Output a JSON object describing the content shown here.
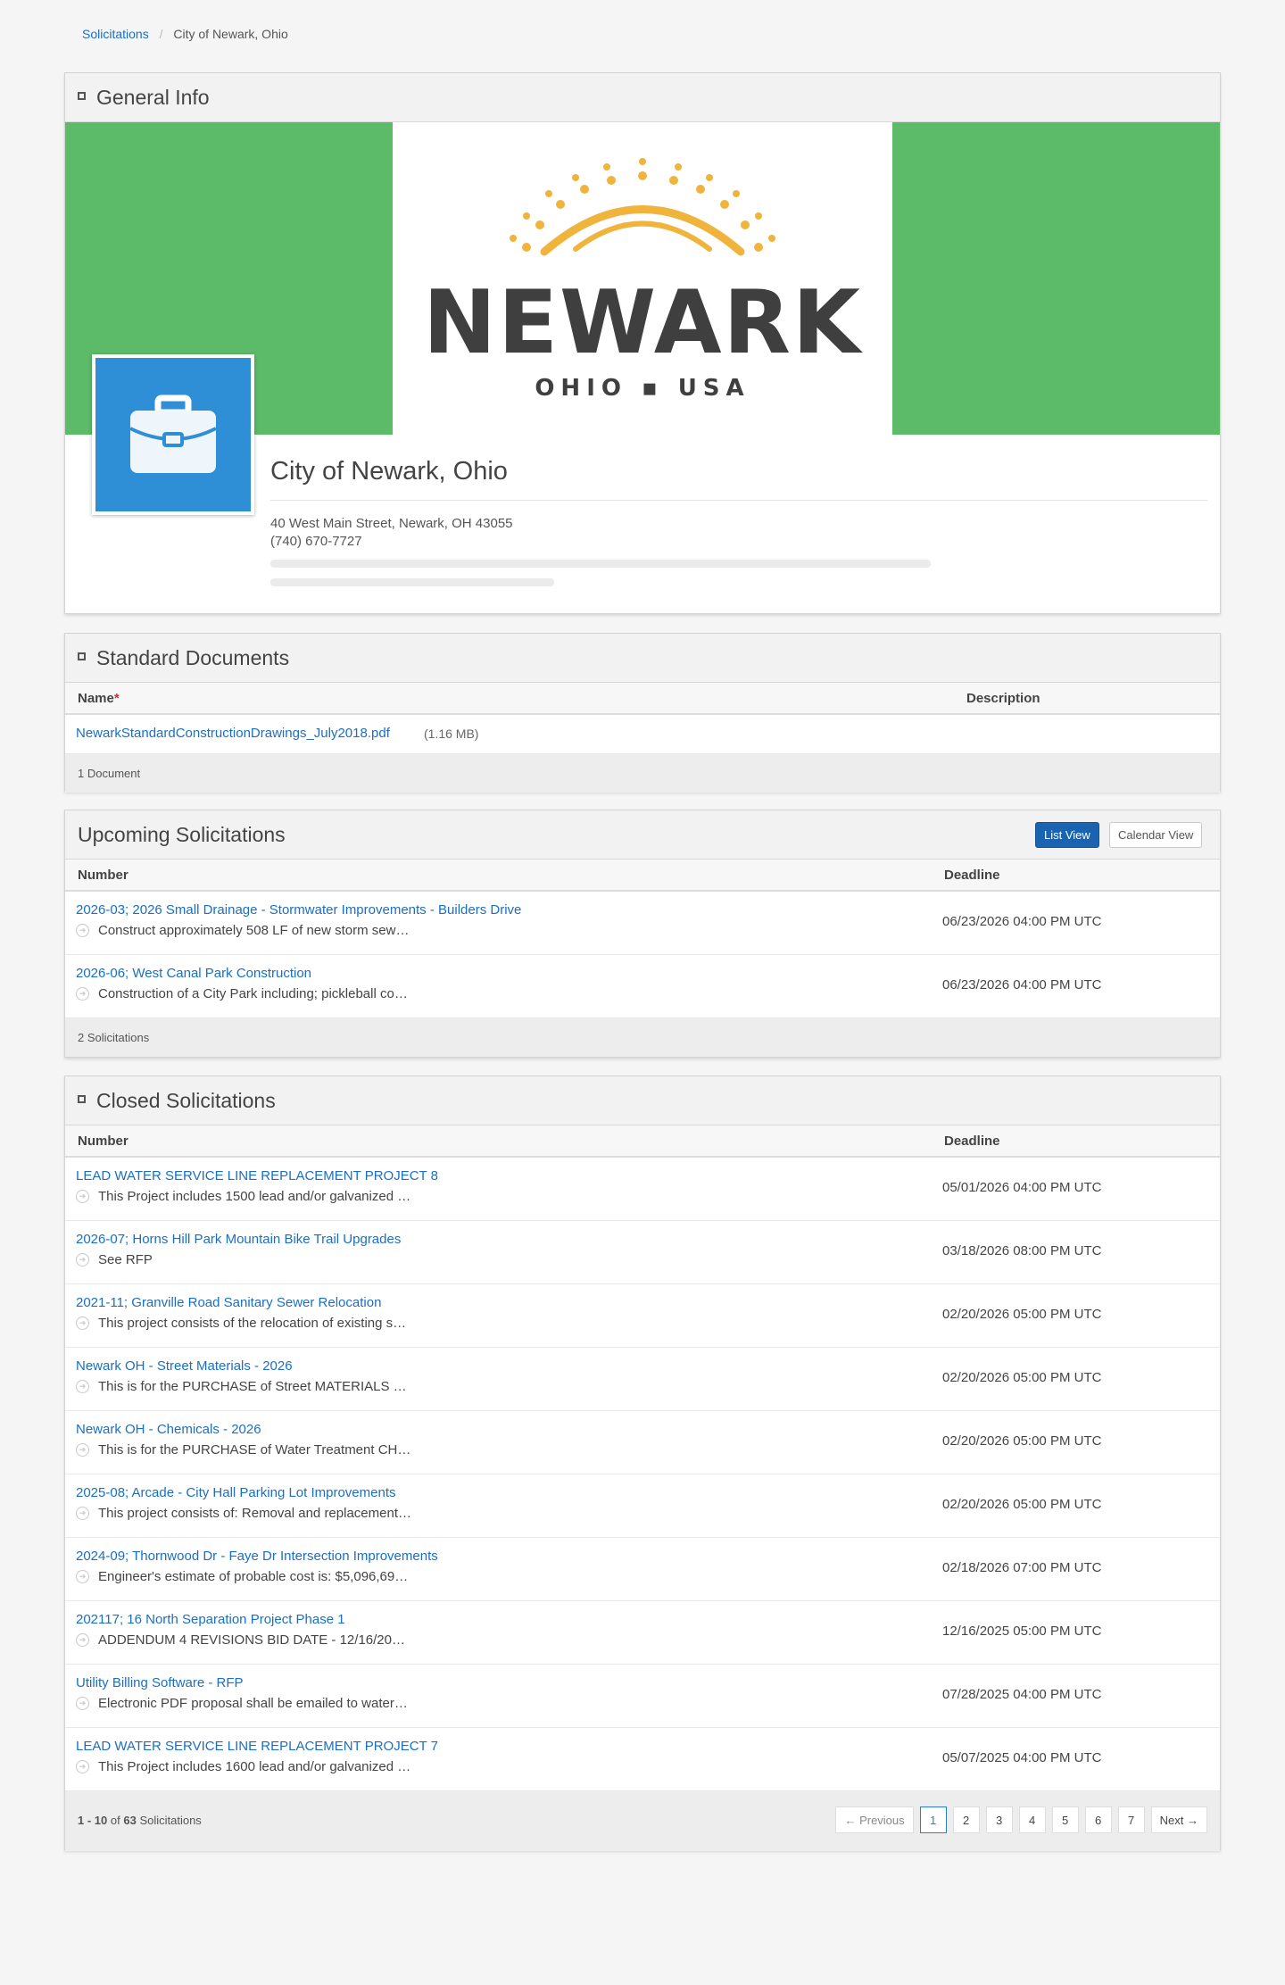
{
  "breadcrumb": {
    "parent": "Solicitations",
    "current": "City of Newark, Ohio"
  },
  "general": {
    "title": "General Info",
    "logo_word": "NEWARK",
    "logo_sub": "OHIO ▪ USA",
    "org_name": "City of Newark, Ohio",
    "address": "40 West Main Street, Newark, OH 43055",
    "phone": "(740) 670-7727"
  },
  "documents": {
    "title": "Standard Documents",
    "col_name": "Name",
    "col_desc": "Description",
    "rows": [
      {
        "name": "NewarkStandardConstructionDrawings_July2018.pdf",
        "size": "(1.16 MB)"
      }
    ],
    "count": "1 Document"
  },
  "upcoming": {
    "title": "Upcoming Solicitations",
    "list_view": "List View",
    "calendar_view": "Calendar View",
    "col_number": "Number",
    "col_deadline": "Deadline",
    "rows": [
      {
        "title": "2026-03; 2026 Small Drainage - Stormwater Improvements - Builders Drive",
        "desc": "Construct approximately 508 LF of new storm sew…",
        "deadline": "06/23/2026 04:00 PM UTC"
      },
      {
        "title": "2026-06; West Canal Park Construction",
        "desc": "Construction of a City Park including; pickleball co…",
        "deadline": "06/23/2026 04:00 PM UTC"
      }
    ],
    "count": "2 Solicitations"
  },
  "closed": {
    "title": "Closed Solicitations",
    "col_number": "Number",
    "col_deadline": "Deadline",
    "rows": [
      {
        "title": "LEAD WATER SERVICE LINE REPLACEMENT PROJECT 8",
        "desc": "This Project includes 1500 lead and/or galvanized …",
        "deadline": "05/01/2026 04:00 PM UTC"
      },
      {
        "title": "2026-07; Horns Hill Park Mountain Bike Trail Upgrades",
        "desc": "See RFP",
        "deadline": "03/18/2026 08:00 PM UTC"
      },
      {
        "title": "2021-11; Granville Road Sanitary Sewer Relocation",
        "desc": "This project consists of the relocation of existing s…",
        "deadline": "02/20/2026 05:00 PM UTC"
      },
      {
        "title": "Newark OH - Street Materials - 2026",
        "desc": "This is for the PURCHASE of Street MATERIALS …",
        "deadline": "02/20/2026 05:00 PM UTC"
      },
      {
        "title": "Newark OH - Chemicals - 2026",
        "desc": "This is for the PURCHASE of Water Treatment CH…",
        "deadline": "02/20/2026 05:00 PM UTC"
      },
      {
        "title": "2025-08; Arcade - City Hall Parking Lot Improvements",
        "desc": "This project consists of: Removal and replacement…",
        "deadline": "02/20/2026 05:00 PM UTC"
      },
      {
        "title": "2024-09; Thornwood Dr - Faye Dr Intersection Improvements",
        "desc": "Engineer's estimate of probable cost is: $5,096,69…",
        "deadline": "02/18/2026 07:00 PM UTC"
      },
      {
        "title": "202117; 16 North Separation Project Phase 1",
        "desc": "ADDENDUM 4 REVISIONS BID DATE - 12/16/20…",
        "deadline": "12/16/2025 05:00 PM UTC"
      },
      {
        "title": "Utility Billing Software - RFP",
        "desc": "Electronic PDF proposal shall be emailed to water…",
        "deadline": "07/28/2025 04:00 PM UTC"
      },
      {
        "title": "LEAD WATER SERVICE LINE REPLACEMENT PROJECT 7",
        "desc": "This Project includes 1600 lead and/or galvanized …",
        "deadline": "05/07/2025 04:00 PM UTC"
      }
    ],
    "range": "1 - 10",
    "of_word": "of",
    "total": "63",
    "unit": "Solicitations",
    "pager": {
      "prev": "← Previous",
      "pages": [
        "1",
        "2",
        "3",
        "4",
        "5",
        "6",
        "7"
      ],
      "next": "Next →"
    }
  },
  "colors": {
    "link": "#1a6fc4",
    "banner_green": "#5cbb69",
    "avatar_blue": "#2f8fd6",
    "logo_gold": "#f0b43c"
  },
  "icons": [
    "collapse-icon",
    "briefcase-icon",
    "arrow-circle-icon"
  ]
}
